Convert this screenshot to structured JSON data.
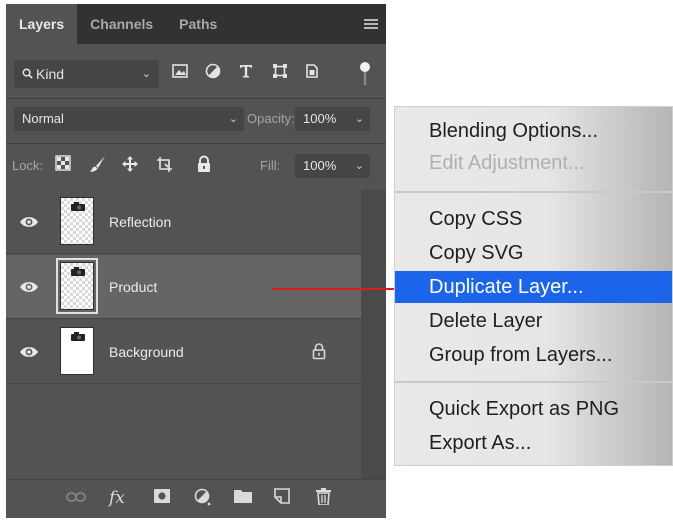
{
  "panel": {
    "tabs": [
      "Layers",
      "Channels",
      "Paths"
    ],
    "active_tab": "Layers",
    "filter": {
      "kind_label": "Kind"
    },
    "blend_mode": "Normal",
    "opacity_label": "Opacity:",
    "opacity_value": "100%",
    "lock_label": "Lock:",
    "fill_label": "Fill:",
    "fill_value": "100%",
    "layers": [
      {
        "name": "Reflection",
        "visible": true,
        "selected": false,
        "locked": false,
        "thumb": "transparent"
      },
      {
        "name": "Product",
        "visible": true,
        "selected": true,
        "locked": false,
        "thumb": "transparent"
      },
      {
        "name": "Background",
        "visible": true,
        "selected": false,
        "locked": true,
        "thumb": "white"
      }
    ],
    "bottom_icons": [
      "link-icon",
      "fx-icon",
      "mask-icon",
      "adjustment-icon",
      "folder-icon",
      "new-layer-icon",
      "trash-icon"
    ],
    "fx_label": "fx"
  },
  "context_menu": {
    "items": [
      {
        "label": "Blending Options...",
        "enabled": true
      },
      {
        "label": "Edit Adjustment...",
        "enabled": false
      },
      {
        "label": "Copy CSS",
        "enabled": true
      },
      {
        "label": "Copy SVG",
        "enabled": true
      },
      {
        "label": "Duplicate Layer...",
        "enabled": true,
        "highlighted": true
      },
      {
        "label": "Delete Layer",
        "enabled": true
      },
      {
        "label": "Group from Layers...",
        "enabled": true
      },
      {
        "label": "Quick Export as PNG",
        "enabled": true
      },
      {
        "label": "Export As...",
        "enabled": true
      }
    ]
  },
  "colors": {
    "panel_bg": "#535353",
    "tabbar_bg": "#323232",
    "selected_layer": "#656565",
    "menu_highlight": "#1c64ea",
    "arrow": "#e01b1b"
  }
}
